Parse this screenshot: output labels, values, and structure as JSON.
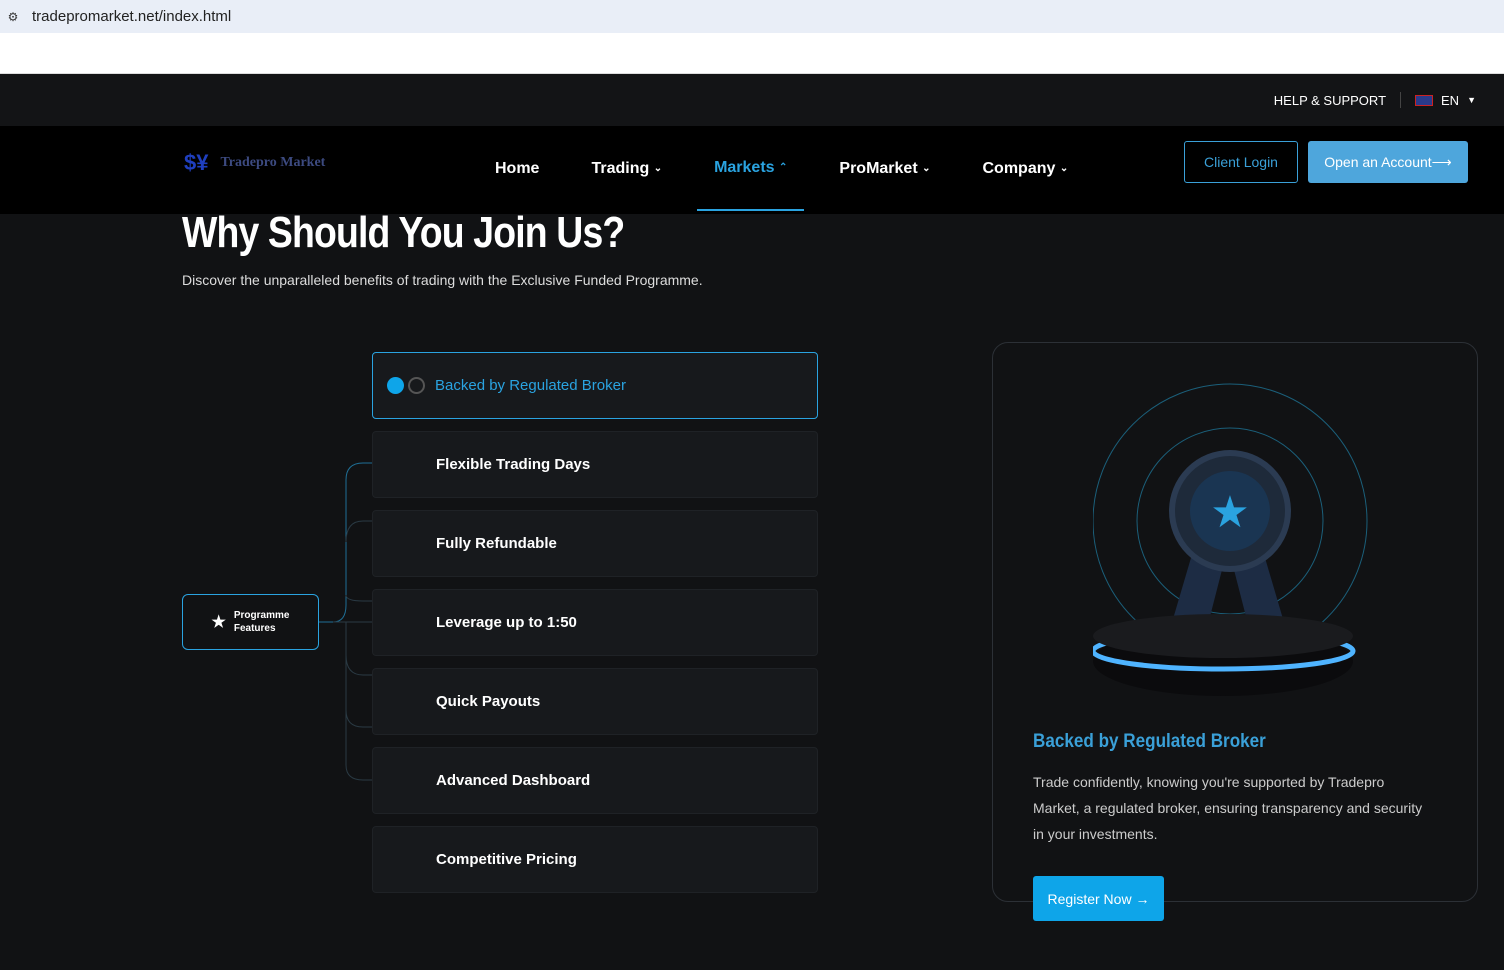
{
  "browser": {
    "url": "tradepromarket.net/index.html"
  },
  "topbar": {
    "help": "HELP & SUPPORT",
    "lang": "EN"
  },
  "nav": {
    "logo": "Tradepro Market",
    "items": [
      "Home",
      "Trading",
      "Markets",
      "ProMarket",
      "Company"
    ],
    "active": "Markets",
    "login": "Client Login",
    "open": "Open an Account"
  },
  "hero": {
    "title": "Why Should You Join Us?",
    "subtitle": "Discover the unparalleled benefits of trading with the Exclusive Funded Programme."
  },
  "programme": {
    "label1": "Programme",
    "label2": "Features"
  },
  "features": [
    "Backed by Regulated Broker",
    "Flexible Trading Days",
    "Fully Refundable",
    "Leverage up to 1:50",
    "Quick Payouts",
    "Advanced Dashboard",
    "Competitive Pricing"
  ],
  "detail": {
    "title": "Backed by Regulated Broker",
    "text": "Trade confidently, knowing you're supported by Tradepro Market, a regulated broker, ensuring transparency and security in your investments.",
    "cta": "Register Now"
  },
  "colors": {
    "accent": "#2aa3e0",
    "button": "#4ea6dc"
  }
}
